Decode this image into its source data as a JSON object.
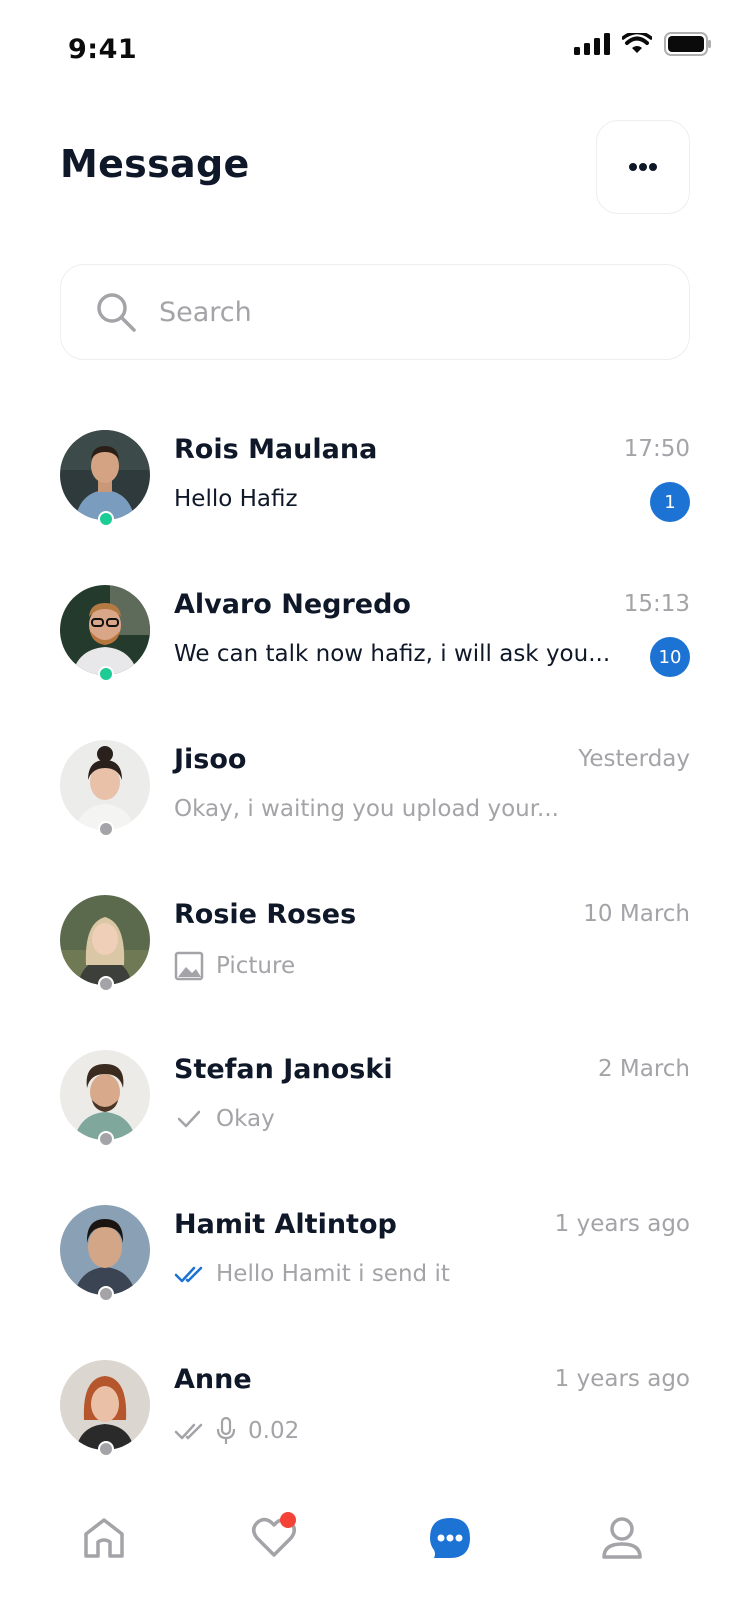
{
  "status_bar": {
    "time": "9:41"
  },
  "header": {
    "title": "Message"
  },
  "search": {
    "placeholder": "Search"
  },
  "colors": {
    "accent": "#1C73D4",
    "online": "#1DCB94",
    "offline": "#A4A4A8",
    "notification": "#F44336"
  },
  "chats": [
    {
      "name": "Rois Maulana",
      "time": "17:50",
      "preview": "Hello Hafiz",
      "unread": "1",
      "status": "online",
      "preview_icon": ""
    },
    {
      "name": "Alvaro Negredo",
      "time": "15:13",
      "preview": "We can talk now hafiz, i will ask you...",
      "unread": "10",
      "status": "online",
      "preview_icon": ""
    },
    {
      "name": "Jisoo",
      "time": "Yesterday",
      "preview": "Okay, i waiting you upload your...",
      "unread": "",
      "status": "offline",
      "preview_icon": ""
    },
    {
      "name": "Rosie Roses",
      "time": "10 March",
      "preview": "Picture",
      "unread": "",
      "status": "offline",
      "preview_icon": "picture-icon"
    },
    {
      "name": "Stefan Janoski",
      "time": "2 March",
      "preview": "Okay",
      "unread": "",
      "status": "offline",
      "preview_icon": "single-check-icon"
    },
    {
      "name": "Hamit Altintop",
      "time": "1 years ago",
      "preview": "Hello Hamit i send it",
      "unread": "",
      "status": "offline",
      "preview_icon": "double-check-read-icon"
    },
    {
      "name": "Anne",
      "time": "1 years ago",
      "preview": "0.02",
      "unread": "",
      "status": "offline",
      "preview_icon": "double-check-microphone-icon"
    }
  ],
  "tab_bar": {
    "tabs": [
      {
        "name": "home-tab",
        "icon": "home-icon",
        "active": false
      },
      {
        "name": "favorites-tab",
        "icon": "heart-icon",
        "active": false,
        "has_notification": true
      },
      {
        "name": "messages-tab",
        "icon": "chat-bubble-icon",
        "active": true
      },
      {
        "name": "profile-tab",
        "icon": "user-icon",
        "active": false
      }
    ]
  }
}
